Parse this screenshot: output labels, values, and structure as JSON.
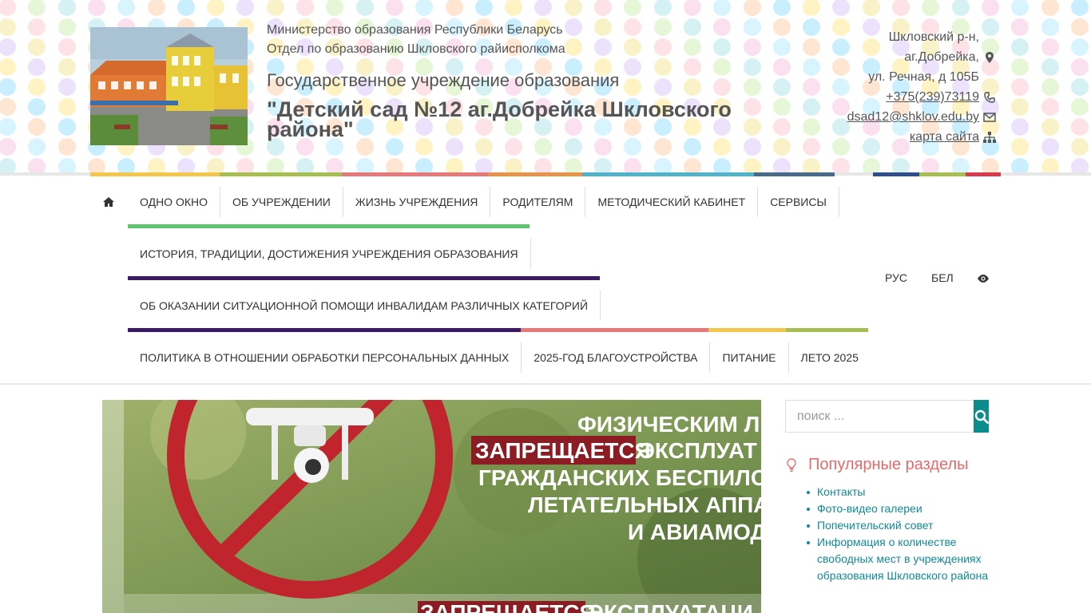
{
  "header": {
    "ministry_line1": "Министерство образования Республики Беларусь",
    "ministry_line2": "Отдел по образованию Шкловского райисполкома",
    "org_type": "Государственное учреждение образования",
    "org_name": "\"Детский сад №12 аг.Добрейка Шкловского района\"",
    "photo_icon": "kindergarten-building-photo"
  },
  "contacts": {
    "address_line1": "Шкловский р-н,",
    "address_line2": "аг.Добрейка,",
    "address_line3": "ул. Речная, д 105Б",
    "phone": "+375(239)73119",
    "email": "dsad12@shklov.edu.by",
    "sitemap": "карта сайта",
    "icons": [
      "map-marker-icon",
      "phone-icon",
      "envelope-icon",
      "sitemap-icon"
    ]
  },
  "nav": {
    "home_icon": "home-icon",
    "row1": [
      "ОДНО ОКНО",
      "ОБ УЧРЕЖДЕНИИ",
      "ЖИЗНЬ УЧРЕЖДЕНИЯ",
      "РОДИТЕЛЯМ",
      "МЕТОДИЧЕСКИЙ КАБИНЕТ",
      "СЕРВИСЫ"
    ],
    "row2": [
      "ИСТОРИЯ, ТРАДИЦИИ, ДОСТИЖЕНИЯ УЧРЕЖДЕНИЯ ОБРАЗОВАНИЯ"
    ],
    "row3": [
      "ОБ ОКАЗАНИИ СИТУАЦИОННОЙ ПОМОЩИ ИНВАЛИДАМ РАЗЛИЧНЫХ КАТЕГОРИЙ"
    ],
    "row4": [
      "ПОЛИТИКА В ОТНОШЕНИИ ОБРАБОТКИ ПЕРСОНАЛЬНЫХ ДАННЫХ",
      "2025-ГОД БЛАГОУСТРОЙСТВА",
      "ПИТАНИЕ",
      "ЛЕТО 2025"
    ],
    "lang_ru": "РУС",
    "lang_by": "БЕЛ",
    "accessibility_icon": "eye-icon"
  },
  "banner": {
    "line1": "ФИЗИЧЕСКИМ ЛИ",
    "line2_highlight": "ЗАПРЕЩАЕТСЯ",
    "line2_rest": "ЭКСПЛУАТ",
    "line3": "ГРАЖДАНСКИХ БЕСПИЛО",
    "line4": "ЛЕТАТЕЛЬНЫХ АППАР",
    "line5": "И АВИАМОД",
    "line6_highlight": "ЗАПРЕЩАЕТСЯ",
    "line6_rest": "ЭКСПЛУАТАЦИ",
    "image_icon": "drone-prohibited-image"
  },
  "sidebar": {
    "search_placeholder": "поиск ...",
    "search_icon": "search-icon",
    "popular_title": "Популярные разделы",
    "popular_icon": "lightbulb-icon",
    "popular_links": [
      "Контакты",
      "Фото-видео галереи",
      "Попечительский совет",
      "Информация о количестве свободных мест в учреждениях образования Шкловского района"
    ]
  },
  "colors": {
    "accent_teal": "#0d8c8c",
    "popular_title": "#e86a6a",
    "strip": [
      "#f2c74c",
      "#a7bf52",
      "#e67a7a",
      "#e8924a",
      "#4fb3c9",
      "#4a6a8a",
      "#2f4e8c",
      "#a7bf52",
      "#d83c4c"
    ],
    "nav_lines": [
      "#5cc46a",
      "#3c1a66",
      "#3c1a66",
      "#e67a7a",
      "#f2c74c",
      "#a7bf52"
    ]
  }
}
